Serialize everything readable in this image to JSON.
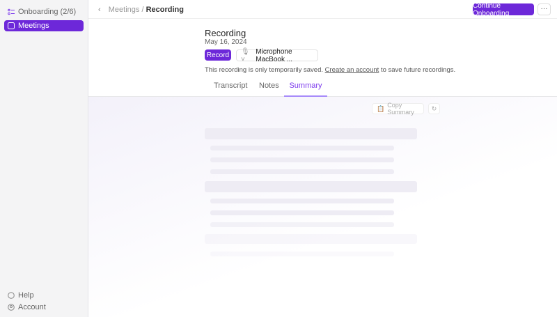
{
  "sidebar": {
    "items": [
      {
        "label": "Onboarding (2/6)"
      },
      {
        "label": "Meetings"
      }
    ],
    "footer": [
      {
        "label": "Help"
      },
      {
        "label": "Account"
      }
    ]
  },
  "header": {
    "breadcrumb_parent": "Meetings",
    "separator": "/",
    "breadcrumb_current": "Recording",
    "continue_label": "Continue Onboarding",
    "more_label": "···"
  },
  "recording": {
    "title": "Recording",
    "date": "May 16, 2024",
    "record_label": "Record",
    "mic_label": "Microphone MacBook ...",
    "notice_pre": "This recording is only temporarily saved.",
    "notice_link": "Create an account",
    "notice_post": "to save future recordings."
  },
  "tabs": [
    {
      "label": "Transcript"
    },
    {
      "label": "Notes"
    },
    {
      "label": "Summary"
    }
  ],
  "summary": {
    "copy_label": "Copy Summary"
  },
  "colors": {
    "accent": "#6d28d9"
  }
}
